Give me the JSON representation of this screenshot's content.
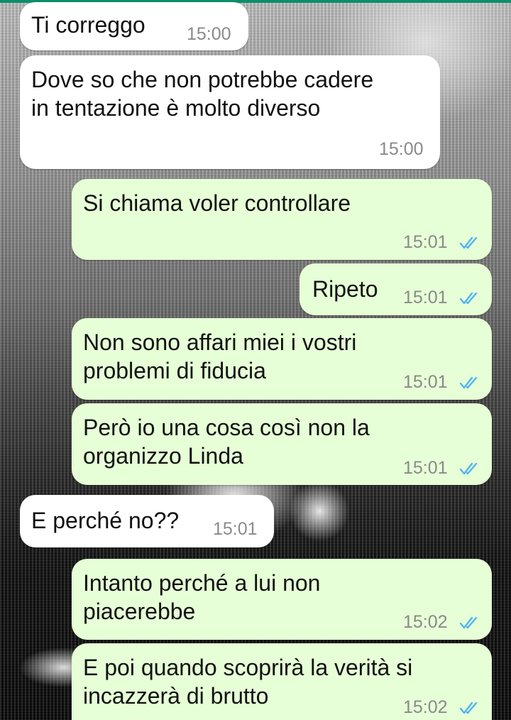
{
  "colors": {
    "incoming_bubble": "#ffffff",
    "outgoing_bubble": "#e6ffd6",
    "read_ticks": "#4fb3f6",
    "timestamp": "#8a8a8a",
    "header_line": "#0b8f6a"
  },
  "messages": [
    {
      "direction": "in",
      "text": "Ti correggo",
      "time": "15:00"
    },
    {
      "direction": "in",
      "text": "Dove so che non potrebbe cadere\nin tentazione è molto diverso",
      "time": "15:00"
    },
    {
      "direction": "out",
      "text": "Si chiama voler controllare",
      "time": "15:01",
      "status_icon": "double-check-read-icon"
    },
    {
      "direction": "out",
      "text": "Ripeto",
      "time": "15:01",
      "status_icon": "double-check-read-icon"
    },
    {
      "direction": "out",
      "text": "Non sono affari miei i vostri\nproblemi di fiducia",
      "time": "15:01",
      "status_icon": "double-check-read-icon"
    },
    {
      "direction": "out",
      "text": "Però io una cosa così non la\norganizzo Linda",
      "time": "15:01",
      "status_icon": "double-check-read-icon"
    },
    {
      "direction": "in",
      "text": "E perché no??",
      "time": "15:01"
    },
    {
      "direction": "out",
      "text": "Intanto perché a lui non\npiacerebbe",
      "time": "15:02",
      "status_icon": "double-check-read-icon"
    },
    {
      "direction": "out",
      "text": "E poi quando scoprirà la verità si\nincazzerà di brutto",
      "time": "15:02",
      "status_icon": "double-check-read-icon"
    }
  ]
}
